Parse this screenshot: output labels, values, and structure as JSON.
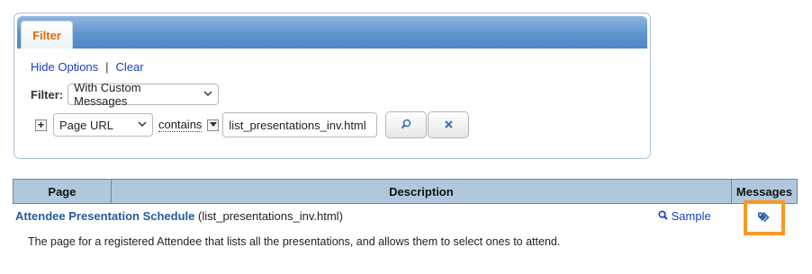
{
  "filter_panel": {
    "tab_label": "Filter",
    "hide_options": "Hide Options",
    "separator": "|",
    "clear": "Clear",
    "filter_label": "Filter:",
    "filter_select_value": "With Custom Messages",
    "criteria": {
      "field": "Page URL",
      "operator": "contains",
      "value": "list_presentations_inv.html"
    }
  },
  "table": {
    "headers": [
      "Page",
      "Description",
      "Messages"
    ],
    "rows": [
      {
        "page_title": "Attendee Presentation Schedule",
        "page_file": "(list_presentations_inv.html)",
        "sample_label": "Sample",
        "description": "The page for a registered Attendee that lists all the presentations, and allows them to select ones to attend."
      }
    ]
  },
  "icons": {
    "search": "search-icon",
    "clear": "close-icon",
    "add": "plus-icon",
    "dropdown": "chevron-down-icon",
    "messages": "tags-icon"
  },
  "colors": {
    "accent_orange": "#f59a22",
    "header_blue": "#b1c7de",
    "link_blue": "#1a3cc8"
  }
}
